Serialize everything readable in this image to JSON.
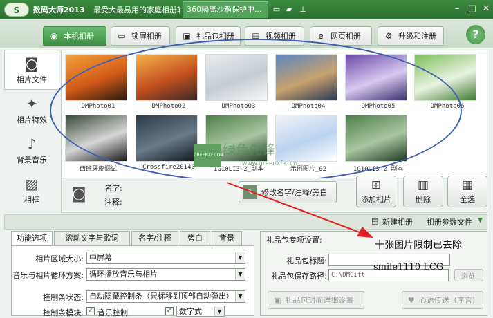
{
  "app": {
    "logo_text": "S",
    "title": "数码大师2013",
    "slogan": "最受大最易用的家庭相册软件",
    "tab_360": "360隔离沙箱保护中..."
  },
  "nav_tabs": [
    {
      "label": "本机相册",
      "icon": "camera-icon",
      "active": true
    },
    {
      "label": "锁屏相册",
      "icon": "monitor-icon",
      "active": false
    },
    {
      "label": "礼品包相册",
      "icon": "gift-icon",
      "active": false
    },
    {
      "label": "视频相册",
      "icon": "film-icon",
      "active": false
    },
    {
      "label": "网页相册",
      "icon": "ie-icon",
      "active": false
    },
    {
      "label": "升级和注册",
      "icon": "gear-icon",
      "active": false
    }
  ],
  "help_label": "?",
  "side_nav": [
    {
      "label": "相片文件",
      "icon": "camera-icon",
      "active": true
    },
    {
      "label": "相片特效",
      "icon": "sparkle-icon",
      "active": false
    },
    {
      "label": "背景音乐",
      "icon": "music-note-icon",
      "active": false
    },
    {
      "label": "相框",
      "icon": "photo-frame-icon",
      "active": false
    }
  ],
  "thumbnails": [
    {
      "label": "DMPhoto01",
      "colors": [
        "#f2a13b",
        "#d25a18",
        "#2a1a10"
      ]
    },
    {
      "label": "DMPhoto02",
      "colors": [
        "#f6b24b",
        "#c24f1e",
        "#3a2a28"
      ]
    },
    {
      "label": "DMPhoto03",
      "colors": [
        "#e9edf0",
        "#c5ccd2",
        "#f7f7f7"
      ]
    },
    {
      "label": "DMPhoto04",
      "colors": [
        "#5b86c2",
        "#c7a26d",
        "#2a3a56"
      ]
    },
    {
      "label": "DMPhoto05",
      "colors": [
        "#6a4aa8",
        "#d7c9ef",
        "#3a2f6a"
      ]
    },
    {
      "label": "DMPhoto06",
      "colors": [
        "#7cbf5a",
        "#e9f3e0",
        "#3d7a2e"
      ]
    },
    {
      "label": "西班牙皮调试",
      "colors": [
        "#3a4a3a",
        "#d6d6d6",
        "#1a1a1a"
      ]
    },
    {
      "label": "Crossfire20140",
      "colors": [
        "#2b3b4a",
        "#6a7a88",
        "#10161c"
      ]
    },
    {
      "label": "1G10LI3-2_副本",
      "colors": [
        "#4f7f4a",
        "#a8c6a0",
        "#203a22"
      ]
    },
    {
      "label": "示例图片_02",
      "colors": [
        "#f4f4f6",
        "#b9d3f0",
        "#ffffff"
      ]
    },
    {
      "label": "1G10LI3-2 副本",
      "colors": [
        "#4f7f4a",
        "#a8c6a0",
        "#203a22"
      ]
    }
  ],
  "watermark": {
    "badge": "GREENXF.COM",
    "text": "绿色先锋",
    "url": "www.greenxf.com"
  },
  "info": {
    "name_label": "名字:",
    "note_label": "注释:"
  },
  "edit_button": "修改名字/注释/旁白",
  "action_buttons": [
    {
      "label": "添加相片",
      "icon": "add-photo-icon"
    },
    {
      "label": "删除",
      "icon": "trash-icon"
    },
    {
      "label": "全选",
      "icon": "grid-icon"
    }
  ],
  "subbar": {
    "new_album": "新建相册",
    "album_settings": "相册参数文件"
  },
  "bottom_tabs": [
    {
      "label": "功能选项",
      "active": true
    },
    {
      "label": "滚动文字与歌词",
      "active": false
    },
    {
      "label": "名字/注释",
      "active": false
    },
    {
      "label": "旁白",
      "active": false
    },
    {
      "label": "背景",
      "active": false
    }
  ],
  "options": {
    "area_size_label": "相片区域大小:",
    "area_size_value": "中屏幕",
    "loop_label": "音乐与相片循环方案:",
    "loop_value": "循环播放音乐与相片",
    "control_state_label": "控制条状态:",
    "control_state_value": "自动隐藏控制条（鼠标移到顶部自动弹出）",
    "control_module_label": "控制条模块:",
    "music_control": "音乐控制",
    "digital_value": "数字式"
  },
  "gift_settings": {
    "title": "礼品包专项设置:",
    "title_label": "礼品包标题:",
    "title_value": "",
    "path_label": "礼品包保存路径:",
    "path_value": "C:\\DMGift",
    "browse": "浏览",
    "cover_button": "礼品包封面详细设置",
    "send_button": "心语传送（序言）"
  },
  "annotations": {
    "line1": "十张图片限制已去除",
    "line2": "smile1110 LCG"
  }
}
